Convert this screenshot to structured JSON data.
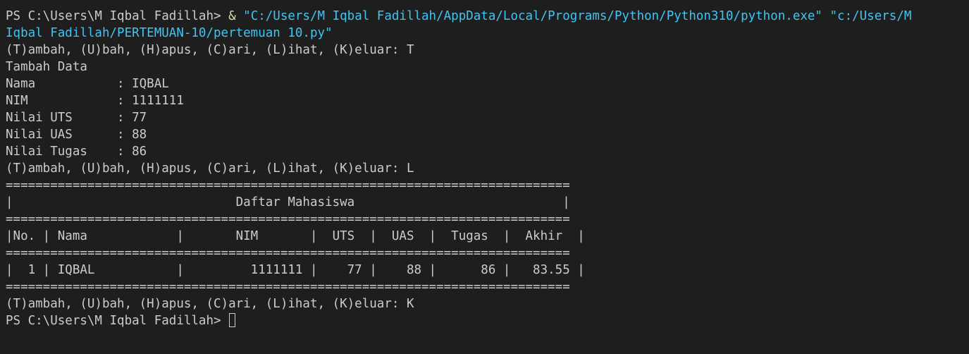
{
  "lines": [
    {
      "prompt": "PS C:\\Users\\M Iqbal Fadillah> ",
      "op": "&",
      "arg": " \"C:/Users/M Iqbal Fadillah/AppData/Local/Programs/Python/Python310/python.exe\" \"c:/Users/M"
    },
    {
      "text": "Iqbal Fadillah/PERTEMUAN-10/pertemuan 10.py\""
    },
    {
      "text": "(T)ambah, (U)bah, (H)apus, (C)ari, (L)ihat, (K)eluar: T"
    },
    {
      "text": "Tambah Data"
    },
    {
      "text": "Nama           : IQBAL"
    },
    {
      "text": "NIM            : 1111111"
    },
    {
      "text": "Nilai UTS      : 77"
    },
    {
      "text": "Nilai UAS      : 88"
    },
    {
      "text": "Nilai Tugas    : 86"
    },
    {
      "text": "(T)ambah, (U)bah, (H)apus, (C)ari, (L)ihat, (K)eluar: L"
    },
    {
      "text": "============================================================================"
    },
    {
      "text": "|                              Daftar Mahasiswa                            |"
    },
    {
      "text": "============================================================================"
    },
    {
      "text": "|No. | Nama            |       NIM       |  UTS  |  UAS  |  Tugas  |  Akhir  |"
    },
    {
      "text": "============================================================================"
    },
    {
      "text": "|  1 | IQBAL           |         1111111 |    77 |    88 |      86 |   83.55 |"
    },
    {
      "text": "============================================================================"
    },
    {
      "text": "(T)ambah, (U)bah, (H)apus, (C)ari, (L)ihat, (K)eluar: K"
    },
    {
      "text": "PS C:\\Users\\M Iqbal Fadillah>"
    }
  ],
  "colors": {
    "background": "#1e1e1e",
    "foreground": "#cccccc",
    "operator": "#dcdcaa",
    "string": "#3ec5f5"
  }
}
